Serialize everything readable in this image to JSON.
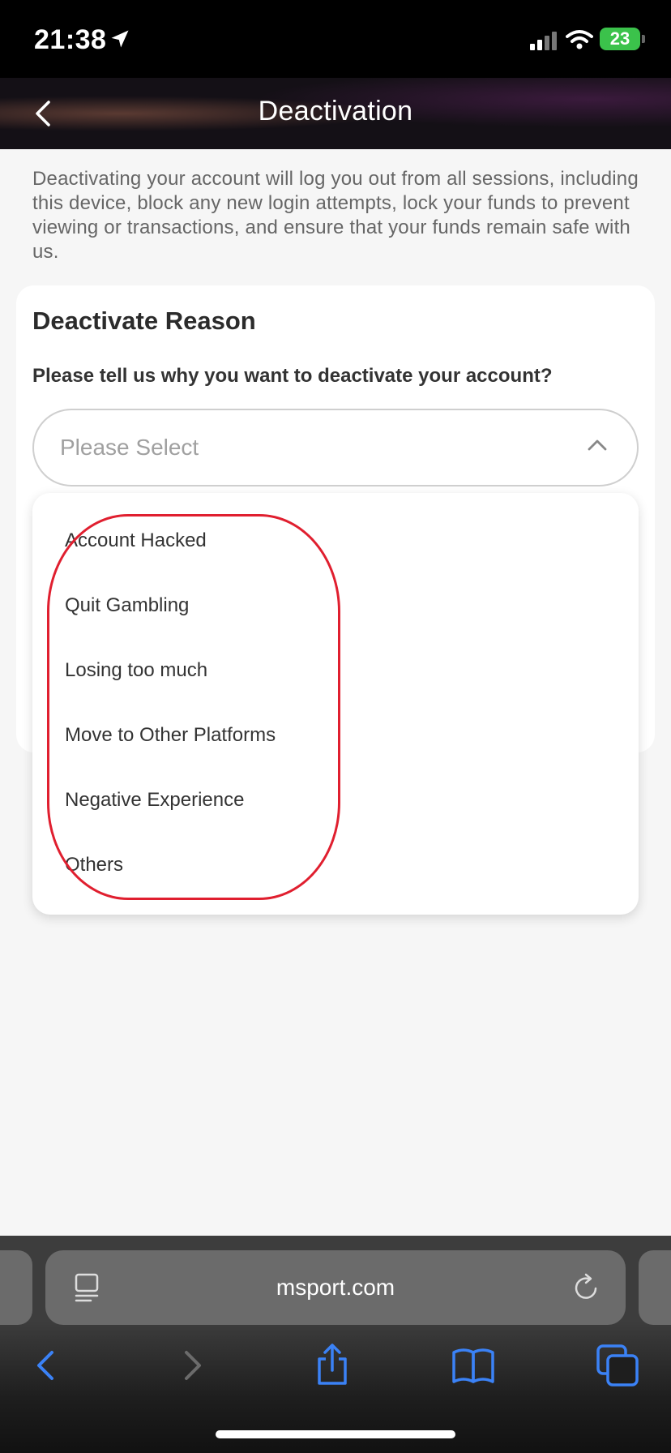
{
  "status_bar": {
    "time": "21:38",
    "battery": "23"
  },
  "header": {
    "title": "Deactivation"
  },
  "intro_text": "Deactivating your account will log you out from all sessions, including this device, block any new login attempts, lock your funds to prevent viewing or transactions, and ensure that your funds remain safe with us.",
  "card": {
    "title": "Deactivate Reason",
    "question": "Please tell us why you want to deactivate your account?",
    "select_placeholder": "Please Select"
  },
  "dropdown_options": [
    "Account Hacked",
    "Quit Gambling",
    "Losing too much",
    "Move to Other Platforms",
    "Negative Experience",
    "Others"
  ],
  "browser": {
    "url": "msport.com"
  },
  "colors": {
    "highlight": "#e01f2f",
    "browser_accent": "#3b82f6",
    "battery": "#3bc24b"
  },
  "icons": [
    "location-arrow-icon",
    "signal-icon",
    "wifi-icon",
    "battery-icon",
    "back-chevron-icon",
    "chevron-up-icon",
    "reader-icon",
    "reload-icon",
    "browser-back-icon",
    "browser-forward-icon",
    "share-icon",
    "bookmarks-icon",
    "tabs-icon"
  ]
}
